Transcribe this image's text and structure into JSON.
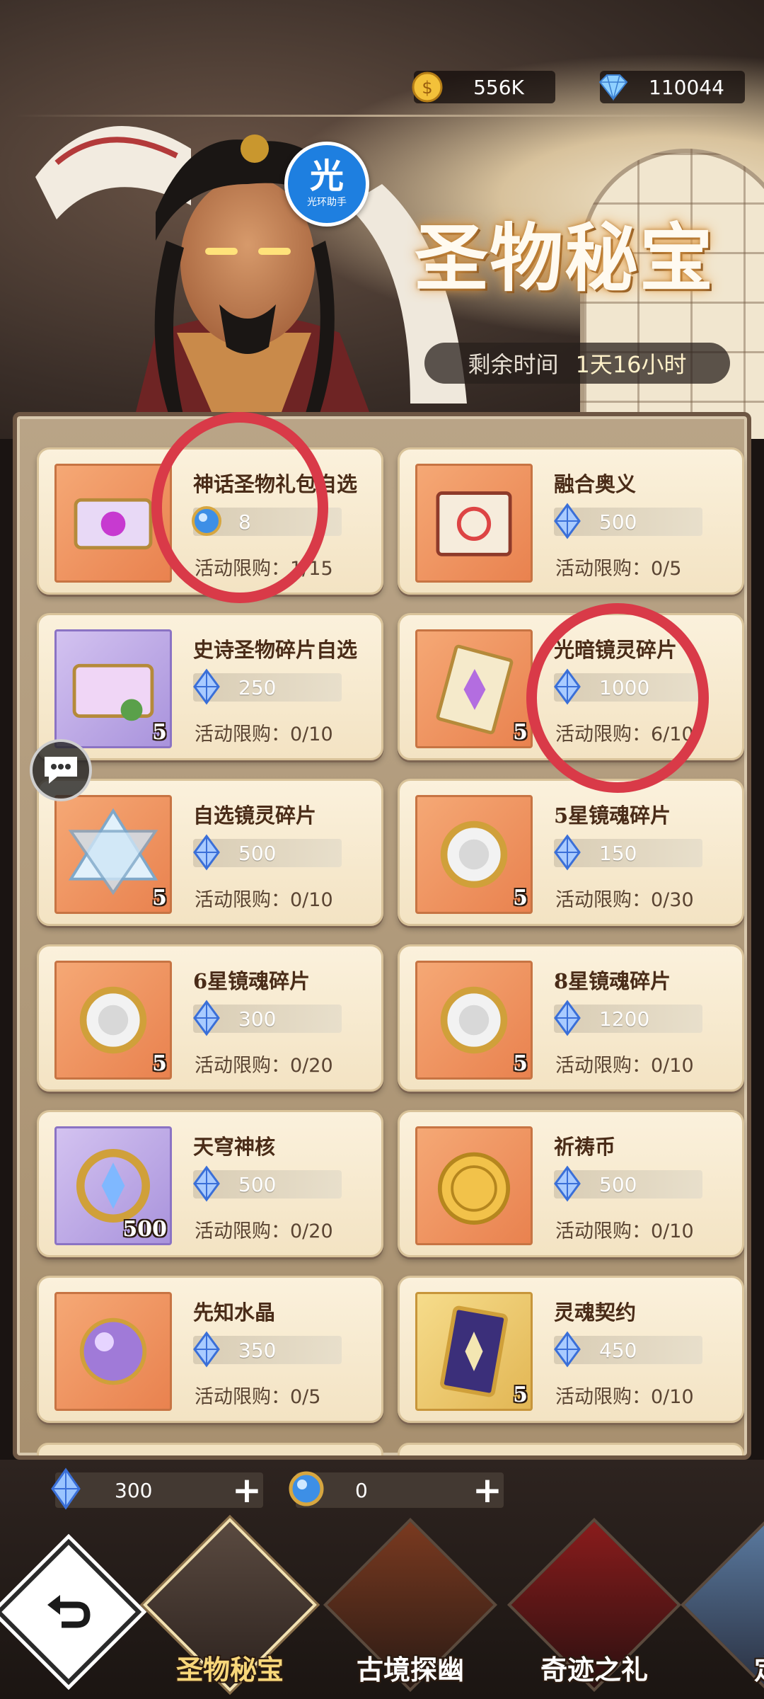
{
  "currencies": {
    "gold": {
      "value": "556K",
      "icon": "gold-coin-icon"
    },
    "gems": {
      "value": "110044",
      "icon": "diamond-icon"
    }
  },
  "helper_badge": {
    "glyph": "光",
    "label": "光环助手"
  },
  "header": {
    "title": "圣物秘宝",
    "timer_label": "剩余时间",
    "timer_value": "1天16小时"
  },
  "shop_items": [
    {
      "name": "神话圣物礼包自选",
      "price": "8",
      "currency": "blue-orb-icon",
      "limit": "活动限购：1/15",
      "thumb": "orange"
    },
    {
      "name": "融合奥义",
      "price": "500",
      "currency": "crystal-icon",
      "limit": "活动限购：0/5",
      "thumb": "orange"
    },
    {
      "name": "史诗圣物碎片自选",
      "price": "250",
      "currency": "crystal-icon",
      "limit": "活动限购：0/10",
      "thumb": "purple",
      "count": "5"
    },
    {
      "name": "光暗镜灵碎片",
      "price": "1000",
      "currency": "crystal-icon",
      "limit": "活动限购：6/10",
      "thumb": "orange",
      "count": "5"
    },
    {
      "name": "自选镜灵碎片",
      "price": "500",
      "currency": "crystal-icon",
      "limit": "活动限购：0/10",
      "thumb": "orange",
      "count": "5"
    },
    {
      "name": "5星镜魂碎片",
      "price": "150",
      "currency": "crystal-icon",
      "limit": "活动限购：0/30",
      "thumb": "orange",
      "count": "5"
    },
    {
      "name": "6星镜魂碎片",
      "price": "300",
      "currency": "crystal-icon",
      "limit": "活动限购：0/20",
      "thumb": "orange",
      "count": "5"
    },
    {
      "name": "8星镜魂碎片",
      "price": "1200",
      "currency": "crystal-icon",
      "limit": "活动限购：0/10",
      "thumb": "orange",
      "count": "5"
    },
    {
      "name": "天穹神核",
      "price": "500",
      "currency": "crystal-icon",
      "limit": "活动限购：0/20",
      "thumb": "purple",
      "count": "500"
    },
    {
      "name": "祈祷币",
      "price": "500",
      "currency": "crystal-icon",
      "limit": "活动限购：0/10",
      "thumb": "orange"
    },
    {
      "name": "先知水晶",
      "price": "350",
      "currency": "crystal-icon",
      "limit": "活动限购：0/5",
      "thumb": "orange"
    },
    {
      "name": "灵魂契约",
      "price": "450",
      "currency": "crystal-icon",
      "limit": "活动限购：0/10",
      "thumb": "gold",
      "count": "5"
    }
  ],
  "wallet": {
    "crystal": {
      "value": "300",
      "icon": "crystal-icon",
      "plus": "+"
    },
    "orb": {
      "value": "0",
      "icon": "blue-orb-icon",
      "plus": "+"
    }
  },
  "nav": {
    "tabs": [
      {
        "label": "圣物秘宝",
        "active": true
      },
      {
        "label": "古境探幽",
        "active": false
      },
      {
        "label": "奇迹之礼",
        "active": false
      },
      {
        "label": "定",
        "active": false
      }
    ]
  },
  "colors": {
    "annotation_circle": "#d93a48",
    "accent_gold": "#f8d77a",
    "card_bg": "#fbf1dc"
  }
}
